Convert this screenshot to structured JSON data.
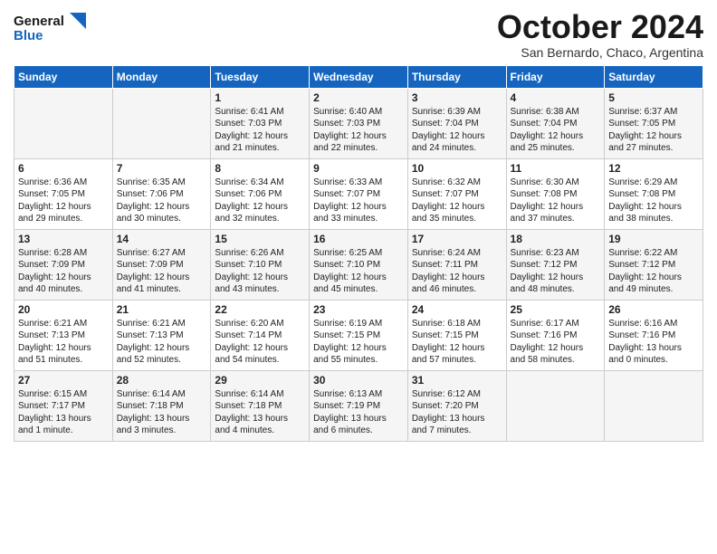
{
  "logo": {
    "general": "General",
    "blue": "Blue"
  },
  "header": {
    "month": "October 2024",
    "location": "San Bernardo, Chaco, Argentina"
  },
  "days_of_week": [
    "Sunday",
    "Monday",
    "Tuesday",
    "Wednesday",
    "Thursday",
    "Friday",
    "Saturday"
  ],
  "weeks": [
    [
      {
        "day": "",
        "info": ""
      },
      {
        "day": "",
        "info": ""
      },
      {
        "day": "1",
        "info": "Sunrise: 6:41 AM\nSunset: 7:03 PM\nDaylight: 12 hours and 21 minutes."
      },
      {
        "day": "2",
        "info": "Sunrise: 6:40 AM\nSunset: 7:03 PM\nDaylight: 12 hours and 22 minutes."
      },
      {
        "day": "3",
        "info": "Sunrise: 6:39 AM\nSunset: 7:04 PM\nDaylight: 12 hours and 24 minutes."
      },
      {
        "day": "4",
        "info": "Sunrise: 6:38 AM\nSunset: 7:04 PM\nDaylight: 12 hours and 25 minutes."
      },
      {
        "day": "5",
        "info": "Sunrise: 6:37 AM\nSunset: 7:05 PM\nDaylight: 12 hours and 27 minutes."
      }
    ],
    [
      {
        "day": "6",
        "info": "Sunrise: 6:36 AM\nSunset: 7:05 PM\nDaylight: 12 hours and 29 minutes."
      },
      {
        "day": "7",
        "info": "Sunrise: 6:35 AM\nSunset: 7:06 PM\nDaylight: 12 hours and 30 minutes."
      },
      {
        "day": "8",
        "info": "Sunrise: 6:34 AM\nSunset: 7:06 PM\nDaylight: 12 hours and 32 minutes."
      },
      {
        "day": "9",
        "info": "Sunrise: 6:33 AM\nSunset: 7:07 PM\nDaylight: 12 hours and 33 minutes."
      },
      {
        "day": "10",
        "info": "Sunrise: 6:32 AM\nSunset: 7:07 PM\nDaylight: 12 hours and 35 minutes."
      },
      {
        "day": "11",
        "info": "Sunrise: 6:30 AM\nSunset: 7:08 PM\nDaylight: 12 hours and 37 minutes."
      },
      {
        "day": "12",
        "info": "Sunrise: 6:29 AM\nSunset: 7:08 PM\nDaylight: 12 hours and 38 minutes."
      }
    ],
    [
      {
        "day": "13",
        "info": "Sunrise: 6:28 AM\nSunset: 7:09 PM\nDaylight: 12 hours and 40 minutes."
      },
      {
        "day": "14",
        "info": "Sunrise: 6:27 AM\nSunset: 7:09 PM\nDaylight: 12 hours and 41 minutes."
      },
      {
        "day": "15",
        "info": "Sunrise: 6:26 AM\nSunset: 7:10 PM\nDaylight: 12 hours and 43 minutes."
      },
      {
        "day": "16",
        "info": "Sunrise: 6:25 AM\nSunset: 7:10 PM\nDaylight: 12 hours and 45 minutes."
      },
      {
        "day": "17",
        "info": "Sunrise: 6:24 AM\nSunset: 7:11 PM\nDaylight: 12 hours and 46 minutes."
      },
      {
        "day": "18",
        "info": "Sunrise: 6:23 AM\nSunset: 7:12 PM\nDaylight: 12 hours and 48 minutes."
      },
      {
        "day": "19",
        "info": "Sunrise: 6:22 AM\nSunset: 7:12 PM\nDaylight: 12 hours and 49 minutes."
      }
    ],
    [
      {
        "day": "20",
        "info": "Sunrise: 6:21 AM\nSunset: 7:13 PM\nDaylight: 12 hours and 51 minutes."
      },
      {
        "day": "21",
        "info": "Sunrise: 6:21 AM\nSunset: 7:13 PM\nDaylight: 12 hours and 52 minutes."
      },
      {
        "day": "22",
        "info": "Sunrise: 6:20 AM\nSunset: 7:14 PM\nDaylight: 12 hours and 54 minutes."
      },
      {
        "day": "23",
        "info": "Sunrise: 6:19 AM\nSunset: 7:15 PM\nDaylight: 12 hours and 55 minutes."
      },
      {
        "day": "24",
        "info": "Sunrise: 6:18 AM\nSunset: 7:15 PM\nDaylight: 12 hours and 57 minutes."
      },
      {
        "day": "25",
        "info": "Sunrise: 6:17 AM\nSunset: 7:16 PM\nDaylight: 12 hours and 58 minutes."
      },
      {
        "day": "26",
        "info": "Sunrise: 6:16 AM\nSunset: 7:16 PM\nDaylight: 13 hours and 0 minutes."
      }
    ],
    [
      {
        "day": "27",
        "info": "Sunrise: 6:15 AM\nSunset: 7:17 PM\nDaylight: 13 hours and 1 minute."
      },
      {
        "day": "28",
        "info": "Sunrise: 6:14 AM\nSunset: 7:18 PM\nDaylight: 13 hours and 3 minutes."
      },
      {
        "day": "29",
        "info": "Sunrise: 6:14 AM\nSunset: 7:18 PM\nDaylight: 13 hours and 4 minutes."
      },
      {
        "day": "30",
        "info": "Sunrise: 6:13 AM\nSunset: 7:19 PM\nDaylight: 13 hours and 6 minutes."
      },
      {
        "day": "31",
        "info": "Sunrise: 6:12 AM\nSunset: 7:20 PM\nDaylight: 13 hours and 7 minutes."
      },
      {
        "day": "",
        "info": ""
      },
      {
        "day": "",
        "info": ""
      }
    ]
  ]
}
